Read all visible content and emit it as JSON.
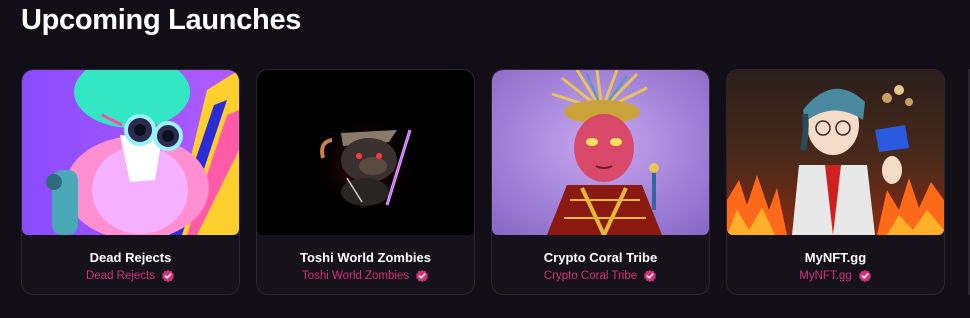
{
  "section": {
    "title": "Upcoming Launches"
  },
  "cards": [
    {
      "name": "Dead Rejects",
      "creator": "Dead Rejects",
      "verified": true,
      "image": "dead-rejects-artwork"
    },
    {
      "name": "Toshi World Zombies",
      "creator": "Toshi World Zombies",
      "verified": true,
      "image": "toshi-world-zombies-artwork"
    },
    {
      "name": "Crypto Coral Tribe",
      "creator": "Crypto Coral Tribe",
      "verified": true,
      "image": "crypto-coral-tribe-artwork"
    },
    {
      "name": "MyNFT.gg",
      "creator": "MyNFT.gg",
      "verified": true,
      "image": "mynft-gg-artwork"
    }
  ],
  "colors": {
    "background": "#120e17",
    "card_background": "#16121c",
    "card_border": "#2a2530",
    "creator_text": "#d6307a",
    "verified_badge": "#d6307a"
  }
}
